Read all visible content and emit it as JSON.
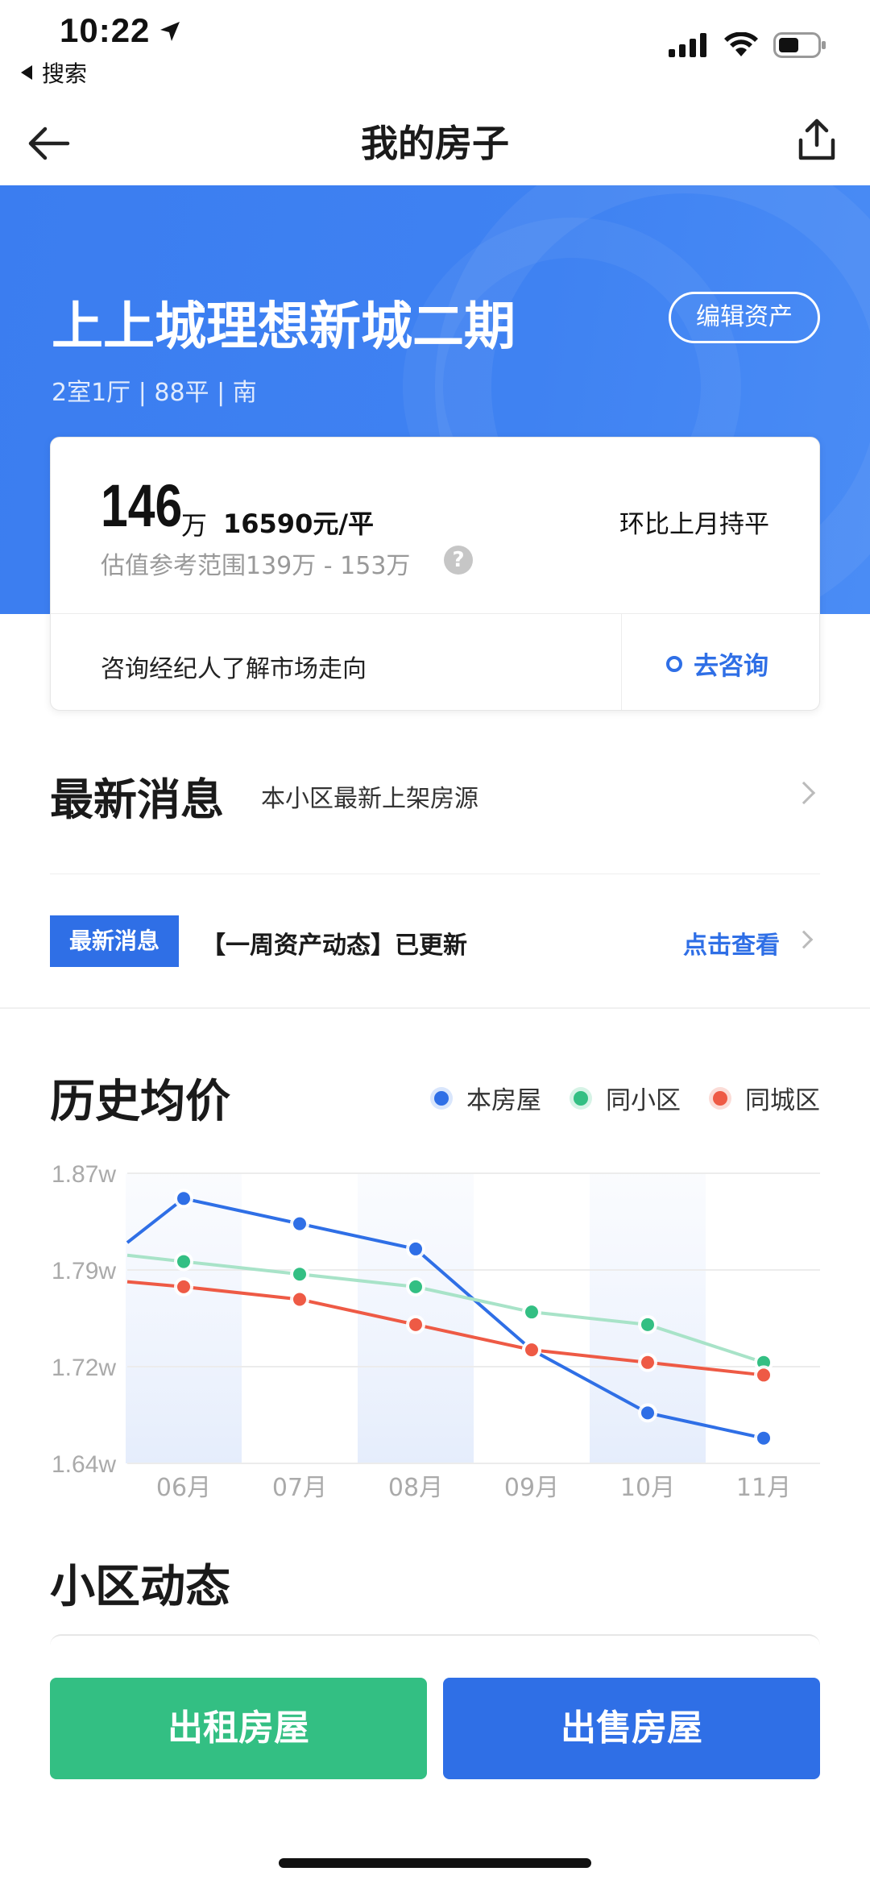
{
  "status_bar": {
    "time": "10:22",
    "back_app": "搜索"
  },
  "nav": {
    "title": "我的房子"
  },
  "estate": {
    "name": "上上城理想新城二期",
    "details": "2室1厅 | 88平 | 南",
    "edit_label": "编辑资产"
  },
  "valuation": {
    "price": "146",
    "price_unit": "万",
    "unit_price": "16590元/平",
    "mom_change": "环比上月持平",
    "range": "估值参考范围139万 - 153万",
    "help": "?",
    "consult_text": "咨询经纪人了解市场走向",
    "consult_button": "去咨询"
  },
  "latest": {
    "title": "最新消息",
    "subtitle": "本小区最新上架房源",
    "badge": "最新消息",
    "news_text": "【一周资产动态】已更新",
    "news_link": "点击查看"
  },
  "history": {
    "title": "历史均价",
    "legend": [
      {
        "name": "本房屋",
        "color": "#2f6fe6"
      },
      {
        "name": "同小区",
        "color": "#33bf83"
      },
      {
        "name": "同城区",
        "color": "#ee5a45"
      }
    ]
  },
  "chart_data": {
    "type": "line",
    "categories": [
      "06月",
      "07月",
      "08月",
      "09月",
      "10月",
      "11月"
    ],
    "y_ticks": [
      "1.87w",
      "1.79w",
      "1.72w",
      "1.64w"
    ],
    "ylim": [
      1.64,
      1.87
    ],
    "grid": true,
    "series": [
      {
        "name": "本房屋",
        "color": "#2f6fe6",
        "values": [
          1.85,
          1.83,
          1.81,
          1.73,
          1.68,
          1.66
        ]
      },
      {
        "name": "同小区",
        "color": "#33bf83",
        "values": [
          1.8,
          1.79,
          1.78,
          1.76,
          1.75,
          1.72
        ]
      },
      {
        "name": "同城区",
        "color": "#ee5a45",
        "values": [
          1.78,
          1.77,
          1.75,
          1.73,
          1.72,
          1.71
        ]
      }
    ]
  },
  "community": {
    "title": "小区动态"
  },
  "actions": {
    "rent": "出租房屋",
    "sell": "出售房屋"
  }
}
